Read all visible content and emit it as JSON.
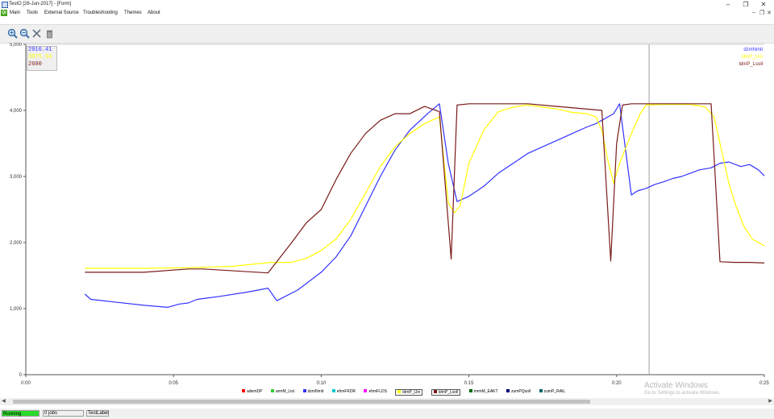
{
  "window": {
    "title": "TestO [26-Jun-2017] - [Form]",
    "minimize_glyph": "–",
    "restore_glyph": "❐",
    "close_glyph": "✕"
  },
  "menubar": {
    "logo_text": "Qt",
    "items": [
      "Main",
      "Tools",
      "External Source",
      "Troubleshooting",
      "Themes",
      "About"
    ],
    "mdi_controls": [
      "–",
      "❐",
      "✕"
    ]
  },
  "toolbar": {
    "tools": [
      {
        "icon": "zoom-in-icon"
      },
      {
        "icon": "zoom-out-icon"
      },
      {
        "icon": "tools-icon"
      },
      {
        "icon": "trash-icon"
      }
    ]
  },
  "chart_data": {
    "type": "line",
    "title": "",
    "xlabel": "",
    "ylabel": "",
    "xlim": [
      0,
      25
    ],
    "ylim": [
      0,
      5000
    ],
    "x_ticks": [
      0,
      5,
      10,
      15,
      20,
      25
    ],
    "x_tick_labels": [
      "0:00",
      "0:05",
      "0:10",
      "0:15",
      "0:20",
      "0:25"
    ],
    "y_ticks": [
      0,
      1000,
      2000,
      3000,
      4000,
      5000
    ],
    "y_tick_labels": [
      "0",
      "1,000",
      "2,000",
      "3,000",
      "4,000",
      "5,000"
    ],
    "grid": false,
    "cursor_x": 21.1,
    "readout_values": [
      "2916.41",
      "3975.94",
      "2600"
    ],
    "series": [
      {
        "name": "dzmNmit",
        "color": "#3333ff",
        "x": [
          2.0,
          2.2,
          3.0,
          4.0,
          4.8,
          5.2,
          5.5,
          5.8,
          6.5,
          7.5,
          8.2,
          8.5,
          9.2,
          10.0,
          10.5,
          11.0,
          11.5,
          12.0,
          12.5,
          13.0,
          13.6,
          14.0,
          14.3,
          14.6,
          15.0,
          15.5,
          16.0,
          16.5,
          17.0,
          17.5,
          18.0,
          18.5,
          19.0,
          19.3,
          19.5,
          19.9,
          20.1,
          20.5,
          20.7,
          21.0,
          21.3,
          21.6,
          21.9,
          22.2,
          22.5,
          22.8,
          23.2,
          23.5,
          23.8,
          24.2,
          24.5,
          24.8,
          25.0
        ],
        "y": [
          1220,
          1140,
          1100,
          1050,
          1020,
          1070,
          1085,
          1140,
          1180,
          1250,
          1310,
          1120,
          1280,
          1550,
          1780,
          2100,
          2550,
          3000,
          3400,
          3700,
          3950,
          4100,
          3200,
          2620,
          2700,
          2850,
          3050,
          3200,
          3350,
          3450,
          3550,
          3650,
          3750,
          3800,
          3850,
          3950,
          4100,
          2720,
          2780,
          2820,
          2880,
          2920,
          2970,
          3000,
          3050,
          3100,
          3130,
          3200,
          3220,
          3150,
          3180,
          3100,
          3010
        ]
      },
      {
        "name": "ldmP_Llin",
        "color": "#ffff00",
        "x": [
          2.0,
          4.0,
          5.5,
          7.0,
          8.3,
          9.0,
          9.5,
          10.0,
          10.5,
          11.0,
          11.5,
          12.0,
          12.5,
          13.0,
          13.5,
          14.0,
          14.3,
          14.5,
          14.7,
          15.0,
          15.5,
          16.0,
          16.5,
          17.0,
          17.5,
          18.0,
          18.5,
          19.0,
          19.3,
          19.5,
          19.7,
          19.9,
          20.1,
          20.5,
          20.8,
          21.0,
          21.5,
          22.0,
          22.5,
          23.0,
          23.3,
          23.6,
          23.8,
          24.0,
          24.3,
          24.6,
          25.0
        ],
        "y": [
          1610,
          1610,
          1620,
          1640,
          1700,
          1700,
          1760,
          1880,
          2050,
          2350,
          2750,
          3150,
          3450,
          3650,
          3800,
          3900,
          2600,
          2450,
          2550,
          3200,
          3700,
          3980,
          4050,
          4080,
          4050,
          4020,
          3970,
          3950,
          3900,
          3700,
          3250,
          2900,
          3200,
          3650,
          3950,
          4080,
          4090,
          4090,
          4090,
          4050,
          3900,
          3300,
          2900,
          2600,
          2250,
          2050,
          1950
        ]
      },
      {
        "name": "ldmP_Lsoll",
        "color": "#7a1a1a",
        "x": [
          2.0,
          4.0,
          5.5,
          6.0,
          8.2,
          9.0,
          9.5,
          10.0,
          10.5,
          11.0,
          11.5,
          12.0,
          12.5,
          13.0,
          13.5,
          14.0,
          14.4,
          14.6,
          15.0,
          16.0,
          17.0,
          18.0,
          19.0,
          19.5,
          19.8,
          20.0,
          20.2,
          20.5,
          21.0,
          22.0,
          23.0,
          23.2,
          23.5,
          24.0,
          24.5,
          25.0
        ],
        "y": [
          1550,
          1550,
          1600,
          1600,
          1540,
          2000,
          2300,
          2500,
          2950,
          3350,
          3650,
          3850,
          3950,
          3950,
          4060,
          3980,
          1750,
          4080,
          4100,
          4100,
          4100,
          4060,
          4020,
          4000,
          1720,
          3500,
          4080,
          4100,
          4100,
          4100,
          4100,
          4100,
          1710,
          1700,
          1700,
          1690
        ]
      }
    ]
  },
  "legend_top_right": [
    "dzmNmit",
    "ldmP_Llin",
    "ldmP_Lsoll"
  ],
  "bottom_legend": [
    {
      "label": "ademDP",
      "color": "#ff0000",
      "selected": false
    },
    {
      "label": "armM_List",
      "color": "#33cc33",
      "selected": false
    },
    {
      "label": "dzmNmit",
      "color": "#3333ff",
      "selected": false
    },
    {
      "label": "ehmFKDR",
      "color": "#00cccc",
      "selected": false
    },
    {
      "label": "ehmFLDS",
      "color": "#ff00ff",
      "selected": false
    },
    {
      "label": "ldmP_Llin",
      "color": "#ffff00",
      "selected": true
    },
    {
      "label": "ldmP_Lsoll",
      "color": "#7a1a1a",
      "selected": true
    },
    {
      "label": "mrmM_EAKT",
      "color": "#006600",
      "selected": false
    },
    {
      "label": "zumPQsoll",
      "color": "#000080",
      "selected": false
    },
    {
      "label": "zumP_RAIL",
      "color": "#006666",
      "selected": false
    }
  ],
  "watermark": {
    "title": "Activate Windows",
    "subtitle": "Go to Settings to activate Windows."
  },
  "statusbar": {
    "running": "Running",
    "jobs": "0 jobs",
    "label": "TestLabel"
  }
}
